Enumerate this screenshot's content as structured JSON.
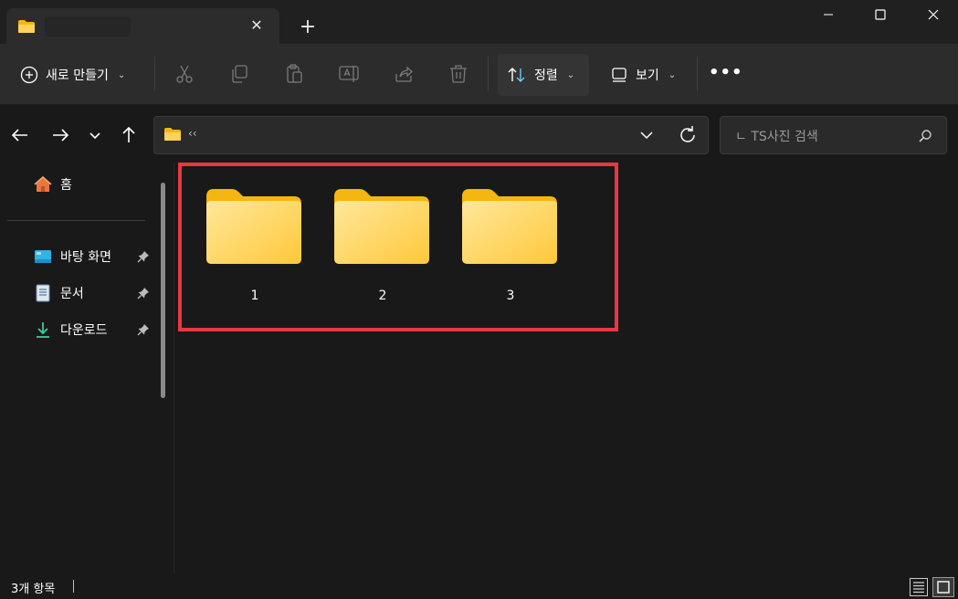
{
  "titlebar": {
    "tab_title": "",
    "icons": [
      "folder-icon",
      "close-icon",
      "plus-icon",
      "minimize-icon",
      "maximize-icon",
      "close-window-icon"
    ]
  },
  "toolbar": {
    "new_label": "새로 만들기",
    "sort_label": "정렬",
    "view_label": "보기",
    "more_label": "•••",
    "icons": [
      "cut-icon",
      "copy-icon",
      "paste-icon",
      "rename-icon",
      "share-icon",
      "delete-icon"
    ]
  },
  "address": {
    "path_text": "‹‹"
  },
  "search": {
    "placeholder": "ㄴ TS사진 검색"
  },
  "sidebar": {
    "home_label": "홈",
    "items": [
      {
        "label": "바탕 화면",
        "icon": "desktop-icon"
      },
      {
        "label": "문서",
        "icon": "documents-icon"
      },
      {
        "label": "다운로드",
        "icon": "download-icon"
      }
    ]
  },
  "content": {
    "folders": [
      {
        "name": "1"
      },
      {
        "name": "2"
      },
      {
        "name": "3"
      }
    ]
  },
  "status": {
    "item_count": "3개 항목"
  },
  "colors": {
    "highlight": "#e8383f",
    "folder_front": "#ffd25a",
    "folder_back": "#f5b70f",
    "background": "#191919"
  }
}
